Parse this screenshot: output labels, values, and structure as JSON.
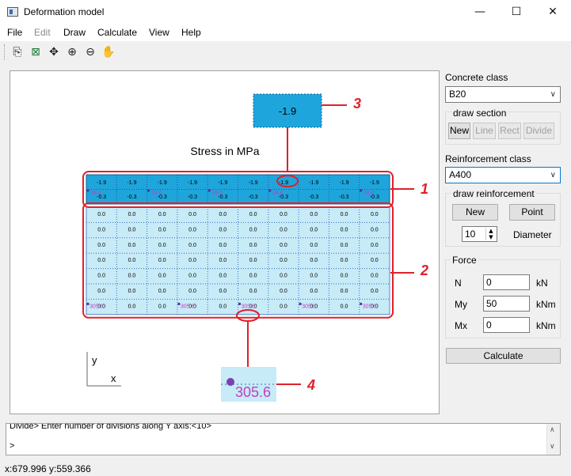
{
  "window": {
    "title": "Deformation model",
    "minimize_glyph": "—",
    "maximize_glyph": "☐",
    "close_glyph": "✕"
  },
  "menu": [
    {
      "label": "File",
      "enabled": true
    },
    {
      "label": "Edit",
      "enabled": false
    },
    {
      "label": "Draw",
      "enabled": true
    },
    {
      "label": "Calculate",
      "enabled": true
    },
    {
      "label": "View",
      "enabled": true
    },
    {
      "label": "Help",
      "enabled": true
    }
  ],
  "toolbar": {
    "icons": [
      {
        "name": "copy-icon",
        "glyph": "⎘"
      },
      {
        "name": "excel-export-icon",
        "glyph": "⊠"
      },
      {
        "name": "fit-view-icon",
        "glyph": "✥"
      },
      {
        "name": "zoom-in-icon",
        "glyph": "⊕"
      },
      {
        "name": "zoom-out-icon",
        "glyph": "⊖"
      },
      {
        "name": "pan-hand-icon",
        "glyph": "✋"
      }
    ]
  },
  "canvas": {
    "heading": "Stress in MPa",
    "top_row": {
      "values_upper": [
        "-1.9",
        "-1.9",
        "-1.9",
        "-1.9",
        "-1.9",
        "-1.9",
        "-1.9",
        "-1.9",
        "-1.9",
        "-1.9"
      ],
      "values_lower": [
        "-0.3",
        "-0.3",
        "-0.3",
        "-0.3",
        "-0.3",
        "-0.3",
        "-0.3",
        "-0.3",
        "-0.3",
        "-0.3"
      ],
      "rebar_labels": [
        "28.6",
        "28.6",
        "28.6",
        "28.6",
        "28.6"
      ]
    },
    "grid": {
      "rows": [
        [
          "0.0",
          "0.0",
          "0.0",
          "0.0",
          "0.0",
          "0.0",
          "0.0",
          "0.0",
          "0.0",
          "0.0"
        ],
        [
          "0.0",
          "0.0",
          "0.0",
          "0.0",
          "0.0",
          "0.0",
          "0.0",
          "0.0",
          "0.0",
          "0.0"
        ],
        [
          "0.0",
          "0.0",
          "0.0",
          "0.0",
          "0.0",
          "0.0",
          "0.0",
          "0.0",
          "0.0",
          "0.0"
        ],
        [
          "0.0",
          "0.0",
          "0.0",
          "0.0",
          "0.0",
          "0.0",
          "0.0",
          "0.0",
          "0.0",
          "0.0"
        ],
        [
          "0.0",
          "0.0",
          "0.0",
          "0.0",
          "0.0",
          "0.0",
          "0.0",
          "0.0",
          "0.0",
          "0.0"
        ],
        [
          "0.0",
          "0.0",
          "0.0",
          "0.0",
          "0.0",
          "0.0",
          "0.0",
          "0.0",
          "0.0",
          "0.0"
        ],
        [
          "0.0",
          "0.0",
          "0.0",
          "0.0",
          "0.0",
          "0.0",
          "0.0",
          "0.0",
          "0.0",
          "0.0"
        ]
      ],
      "rebar_labels": [
        "305.6",
        "305.6",
        "305.6",
        "305.6",
        "305.6"
      ]
    },
    "zoom_top": "-1.9",
    "zoom_bottom": "305.6",
    "callouts": [
      "1",
      "2",
      "3",
      "4"
    ],
    "axis_y": "y",
    "axis_x": "x",
    "colors": {
      "compression": "#1ea6dc",
      "zero": "#c7ebf7",
      "callout": "#e0202a",
      "rebar_label": "#c040c0"
    }
  },
  "panel": {
    "concrete_label": "Concrete class",
    "concrete_value": "B20",
    "draw_section_label": "draw section",
    "section_buttons": [
      {
        "label": "New",
        "enabled": true
      },
      {
        "label": "Line",
        "enabled": false
      },
      {
        "label": "Rect",
        "enabled": false
      },
      {
        "label": "Divide",
        "enabled": false
      }
    ],
    "reinforcement_label": "Reinforcement class",
    "reinforcement_value": "A400",
    "draw_reinf_label": "draw reinforcement",
    "reinf_new": "New",
    "reinf_point": "Point",
    "diameter_value": "10",
    "diameter_label": "Diameter",
    "force_label": "Force",
    "forces": [
      {
        "name": "N",
        "value": "0",
        "unit": "kN"
      },
      {
        "name": "My",
        "value": "50",
        "unit": "kNm"
      },
      {
        "name": "Mx",
        "value": "0",
        "unit": "kNm"
      }
    ],
    "calculate_label": "Calculate"
  },
  "console": {
    "history": "Divide> Enter number of divisions along Y axis:<10>",
    "prompt": ">"
  },
  "status": "x:679.996 y:559.366"
}
